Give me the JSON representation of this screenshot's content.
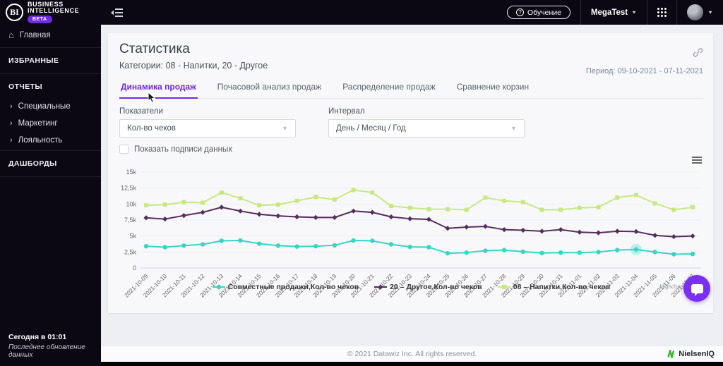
{
  "brand": {
    "initials": "BI",
    "line1": "BUSINESS",
    "line2": "INTELLIGENCE",
    "beta_label": "BETA"
  },
  "topbar": {
    "training_label": "Обучение",
    "workspace": "MegaTest"
  },
  "sidebar": {
    "home_label": "Главная",
    "favorites_label": "ИЗБРАННЫЕ",
    "reports_label": "ОТЧЕТЫ",
    "reports_items": [
      {
        "label": "Специальные"
      },
      {
        "label": "Маркетинг"
      },
      {
        "label": "Лояльность"
      }
    ],
    "dashboards_label": "ДАШБОРДЫ",
    "last_update_time": "Сегодня в 01:01",
    "last_update_caption": "Последнее обновление данных"
  },
  "page": {
    "title": "Статистика",
    "subtitle": "Категории: 08 - Напитки, 20 - Другое",
    "period": "Период: 09-10-2021 - 07-11-2021",
    "tabs": [
      {
        "label": "Динамика продаж",
        "active": true
      },
      {
        "label": "Почасовой анализ продаж",
        "active": false
      },
      {
        "label": "Распределение продаж",
        "active": false
      },
      {
        "label": "Сравнение корзин",
        "active": false
      }
    ],
    "filters": {
      "indicators_label": "Показатели",
      "indicators_value": "Кол-во чеков",
      "interval_label": "Интервал",
      "interval_value": "День / Месяц / Год",
      "checkbox_label": "Показать подписи данных",
      "checkbox_checked": false
    }
  },
  "chart_data": {
    "type": "line",
    "x": [
      "2021-10-09",
      "2021-10-10",
      "2021-10-11",
      "2021-10-12",
      "2021-10-13",
      "2021-10-14",
      "2021-10-15",
      "2021-10-16",
      "2021-10-17",
      "2021-10-18",
      "2021-10-19",
      "2021-10-20",
      "2021-10-21",
      "2021-10-22",
      "2021-10-23",
      "2021-10-24",
      "2021-10-25",
      "2021-10-26",
      "2021-10-27",
      "2021-10-28",
      "2021-10-29",
      "2021-10-30",
      "2021-10-31",
      "2021-11-01",
      "2021-11-02",
      "2021-11-03",
      "2021-11-04",
      "2021-11-05",
      "2021-11-06",
      "2021-11-07"
    ],
    "series": [
      {
        "name": "Совместные продажи,Кол-во чеков",
        "color": "#35d6c3",
        "marker": "circle",
        "values": [
          3400,
          3250,
          3500,
          3700,
          4250,
          4300,
          3800,
          3500,
          3350,
          3400,
          3550,
          4300,
          4250,
          3700,
          3300,
          3250,
          2300,
          2400,
          2700,
          2800,
          2550,
          2350,
          2400,
          2400,
          2500,
          2800,
          2900,
          2500,
          2150,
          2200
        ]
      },
      {
        "name": "20 – Другое,Кол-во чеков",
        "color": "#552d5e",
        "marker": "diamond",
        "values": [
          7850,
          7650,
          8200,
          8700,
          9500,
          8900,
          8400,
          8150,
          8000,
          7900,
          7900,
          8900,
          8700,
          8000,
          7700,
          7600,
          6200,
          6400,
          6500,
          6000,
          5900,
          5750,
          6000,
          5600,
          5500,
          5750,
          5700,
          5100,
          4900,
          5000
        ]
      },
      {
        "name": "08 – Напитки,Кол-во чеков",
        "color": "#c6e97f",
        "marker": "square",
        "values": [
          9800,
          9900,
          10300,
          10200,
          11800,
          10900,
          9800,
          9900,
          10500,
          11100,
          10700,
          12200,
          11800,
          9700,
          9400,
          9200,
          9200,
          9100,
          11000,
          10500,
          10300,
          9100,
          9100,
          9400,
          9500,
          11000,
          11400,
          10100,
          9100,
          9500
        ]
      }
    ],
    "ylim": [
      0,
      15000
    ],
    "yticks": [
      "0",
      "2,5k",
      "5k",
      "7,5k",
      "10k",
      "12,5k",
      "15k"
    ],
    "grid": true,
    "legend_position": "bottom",
    "highlighted_point": {
      "series": 0,
      "index": 26
    },
    "credits": "Highcharts.com"
  },
  "footer": {
    "copyright": "© 2021 Datawiz Inc. All rights reserved.",
    "partner_brand": "NielsenIQ"
  },
  "colors": {
    "accent": "#6d2ce0",
    "sidebar_bg": "#0b0713",
    "card_bg": "#f8f8fb",
    "niq_green": "#3db12e",
    "chat_fab": "#7b2ff2"
  }
}
